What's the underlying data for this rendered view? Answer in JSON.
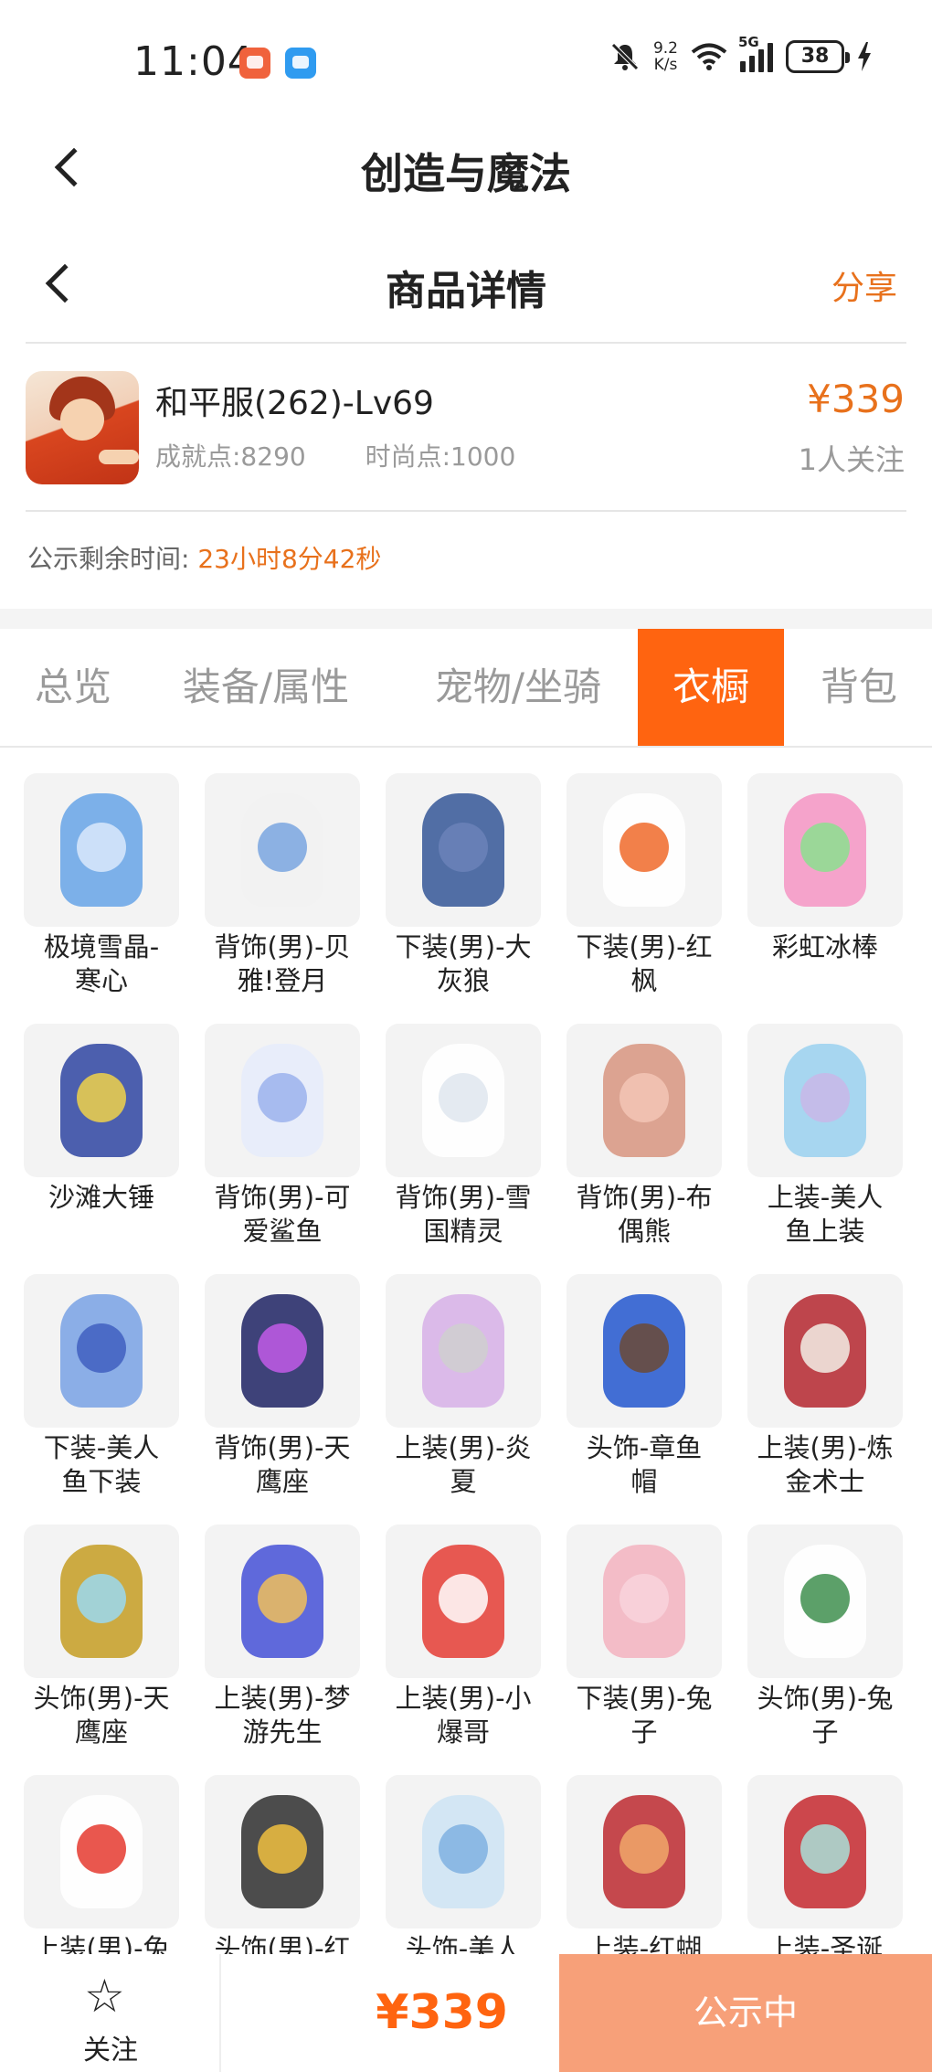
{
  "status_bar": {
    "time": "11:04",
    "net_speed_value": "9.2",
    "net_speed_unit": "K/s",
    "network_type": "5G",
    "battery": "38",
    "icons": [
      "app-icon-red",
      "app-icon-blue",
      "mute-icon",
      "wifi-icon",
      "signal-icon",
      "battery-icon",
      "charging-icon"
    ]
  },
  "app_header": {
    "title": "创造与魔法"
  },
  "sub_header": {
    "title": "商品详情",
    "share_label": "分享"
  },
  "product": {
    "name": "和平服(262)-Lv69",
    "achievement": "成就点:8290",
    "fashion": "时尚点:1000",
    "price": "¥339",
    "followers": "1人关注"
  },
  "countdown": {
    "label": "公示剩余时间:",
    "value": "23小时8分42秒"
  },
  "tabs": [
    {
      "label": "总览",
      "active": false
    },
    {
      "label": "装备/属性",
      "active": false
    },
    {
      "label": "宠物/坐骑",
      "active": false
    },
    {
      "label": "衣橱",
      "active": true
    },
    {
      "label": "背包",
      "active": false
    }
  ],
  "items": [
    {
      "line1": "极境雪晶-",
      "line2": "寒心"
    },
    {
      "line1": "背饰(男)-贝",
      "line2": "雅!登月"
    },
    {
      "line1": "下装(男)-大",
      "line2": "灰狼"
    },
    {
      "line1": "下装(男)-红",
      "line2": "枫"
    },
    {
      "line1": "彩虹冰棒",
      "line2": ""
    },
    {
      "line1": "沙滩大锤",
      "line2": ""
    },
    {
      "line1": "背饰(男)-可",
      "line2": "爱鲨鱼"
    },
    {
      "line1": "背饰(男)-雪",
      "line2": "国精灵"
    },
    {
      "line1": "背饰(男)-布",
      "line2": "偶熊"
    },
    {
      "line1": "上装-美人",
      "line2": "鱼上装"
    },
    {
      "line1": "下装-美人",
      "line2": "鱼下装"
    },
    {
      "line1": "背饰(男)-天",
      "line2": "鹰座"
    },
    {
      "line1": "上装(男)-炎",
      "line2": "夏"
    },
    {
      "line1": "头饰-章鱼",
      "line2": "帽"
    },
    {
      "line1": "上装(男)-炼",
      "line2": "金术士"
    },
    {
      "line1": "头饰(男)-天",
      "line2": "鹰座"
    },
    {
      "line1": "上装(男)-梦",
      "line2": "游先生"
    },
    {
      "line1": "上装(男)-小",
      "line2": "爆哥"
    },
    {
      "line1": "下装(男)-兔",
      "line2": "子"
    },
    {
      "line1": "头饰(男)-兔",
      "line2": "子"
    },
    {
      "line1": "上装(男)-兔",
      "line2": ""
    },
    {
      "line1": "头饰(男)-红",
      "line2": ""
    },
    {
      "line1": "头饰-美人",
      "line2": ""
    },
    {
      "line1": "上装-红蝴",
      "line2": ""
    },
    {
      "line1": "上装-圣诞",
      "line2": ""
    }
  ],
  "bottom_bar": {
    "follow_label": "关注",
    "price": "¥339",
    "action_label": "公示中"
  },
  "colors": {
    "accent": "#ff6410",
    "price": "#e8711c",
    "action_disabled": "#f7a079"
  }
}
